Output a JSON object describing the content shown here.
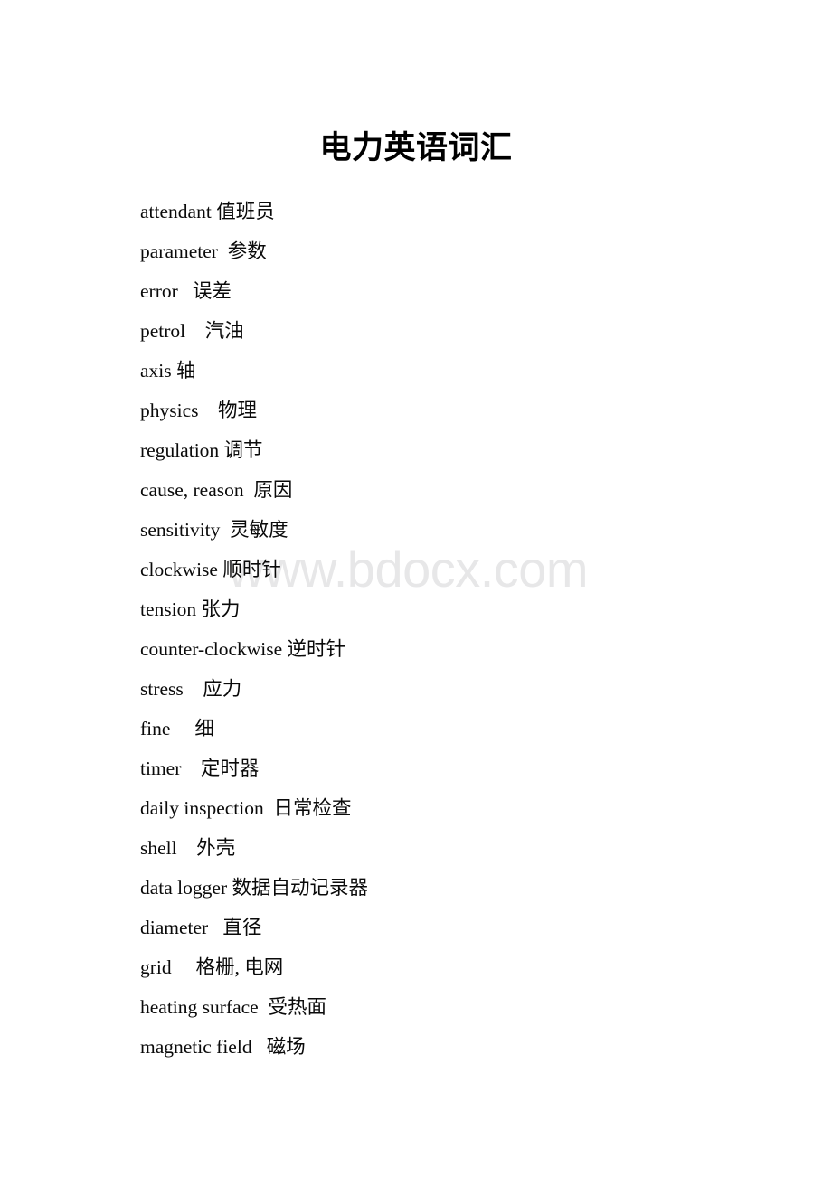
{
  "document": {
    "title": "电力英语词汇",
    "watermark": "www.bdocx.com",
    "page_background": "#ffffff",
    "text_color": "#000000",
    "watermark_color": "#e7e7e8"
  },
  "entries": [
    {
      "term": "attendant",
      "gap": " ",
      "gloss": "值班员"
    },
    {
      "term": "parameter",
      "gap": "  ",
      "gloss": "参数"
    },
    {
      "term": "error",
      "gap": "   ",
      "gloss": "误差"
    },
    {
      "term": "petrol",
      "gap": "    ",
      "gloss": "汽油"
    },
    {
      "term": "axis",
      "gap": " ",
      "gloss": "轴"
    },
    {
      "term": "physics",
      "gap": "    ",
      "gloss": "物理"
    },
    {
      "term": "regulation",
      "gap": " ",
      "gloss": "调节"
    },
    {
      "term": "cause, reason",
      "gap": "  ",
      "gloss": "原因"
    },
    {
      "term": "sensitivity",
      "gap": "  ",
      "gloss": "灵敏度"
    },
    {
      "term": "clockwise",
      "gap": " ",
      "gloss": "顺时针"
    },
    {
      "term": "tension",
      "gap": " ",
      "gloss": "张力"
    },
    {
      "term": "counter-clockwise",
      "gap": " ",
      "gloss": "逆时针"
    },
    {
      "term": "stress",
      "gap": "    ",
      "gloss": "应力"
    },
    {
      "term": "fine",
      "gap": "     ",
      "gloss": "细"
    },
    {
      "term": "timer",
      "gap": "    ",
      "gloss": "定时器"
    },
    {
      "term": "daily inspection",
      "gap": "  ",
      "gloss": "日常检查"
    },
    {
      "term": "shell",
      "gap": "    ",
      "gloss": "外壳"
    },
    {
      "term": "data logger",
      "gap": " ",
      "gloss": "数据自动记录器"
    },
    {
      "term": "diameter",
      "gap": "   ",
      "gloss": "直径"
    },
    {
      "term": "grid",
      "gap": "     ",
      "gloss": "格栅, 电网"
    },
    {
      "term": "heating surface",
      "gap": "  ",
      "gloss": "受热面"
    },
    {
      "term": "magnetic field",
      "gap": "   ",
      "gloss": "磁场"
    }
  ]
}
